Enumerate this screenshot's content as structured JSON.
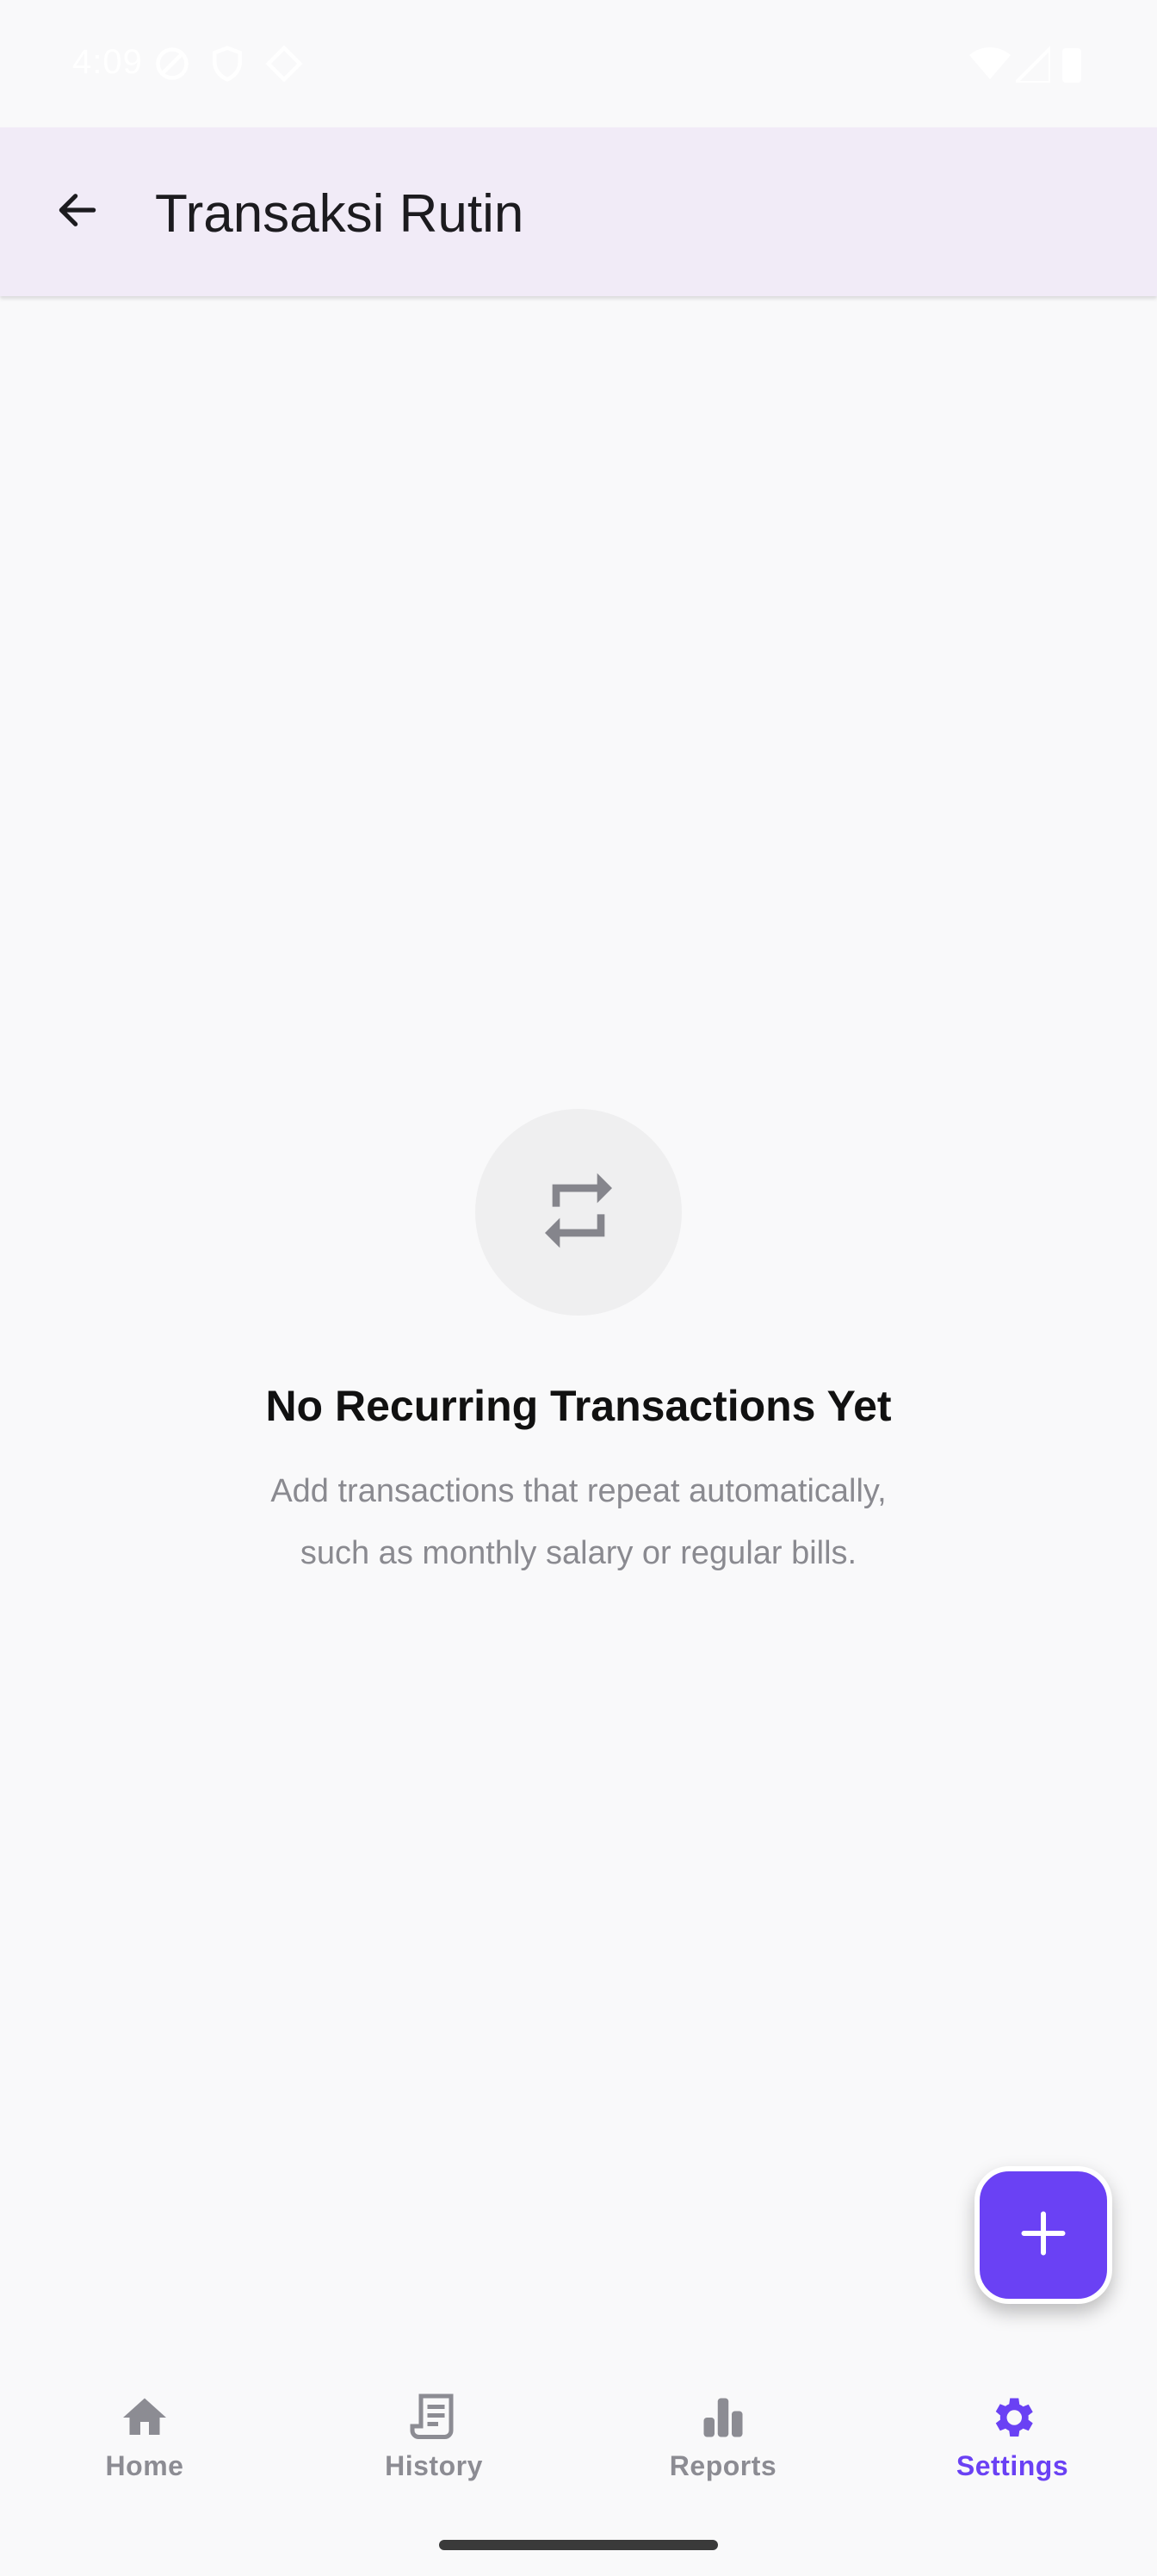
{
  "status_bar": {
    "time": "4:09"
  },
  "app_bar": {
    "title": "Transaksi Rutin",
    "back_icon": "arrow-left-icon"
  },
  "empty_state": {
    "icon": "repeat-icon",
    "title": "No Recurring Transactions Yet",
    "line1": "Add transactions that repeat automatically,",
    "line2": "such as monthly salary or regular bills."
  },
  "fab": {
    "icon": "plus-icon"
  },
  "bottom_nav": {
    "items": [
      {
        "label": "Home",
        "icon": "home-icon",
        "active": false
      },
      {
        "label": "History",
        "icon": "receipt-icon",
        "active": false
      },
      {
        "label": "Reports",
        "icon": "bar-chart-icon",
        "active": false
      },
      {
        "label": "Settings",
        "icon": "gear-icon",
        "active": true
      }
    ]
  },
  "colors": {
    "accent": "#6a41f4",
    "app_bar_bg": "#f1ebf7",
    "inactive": "#8c8c93"
  }
}
